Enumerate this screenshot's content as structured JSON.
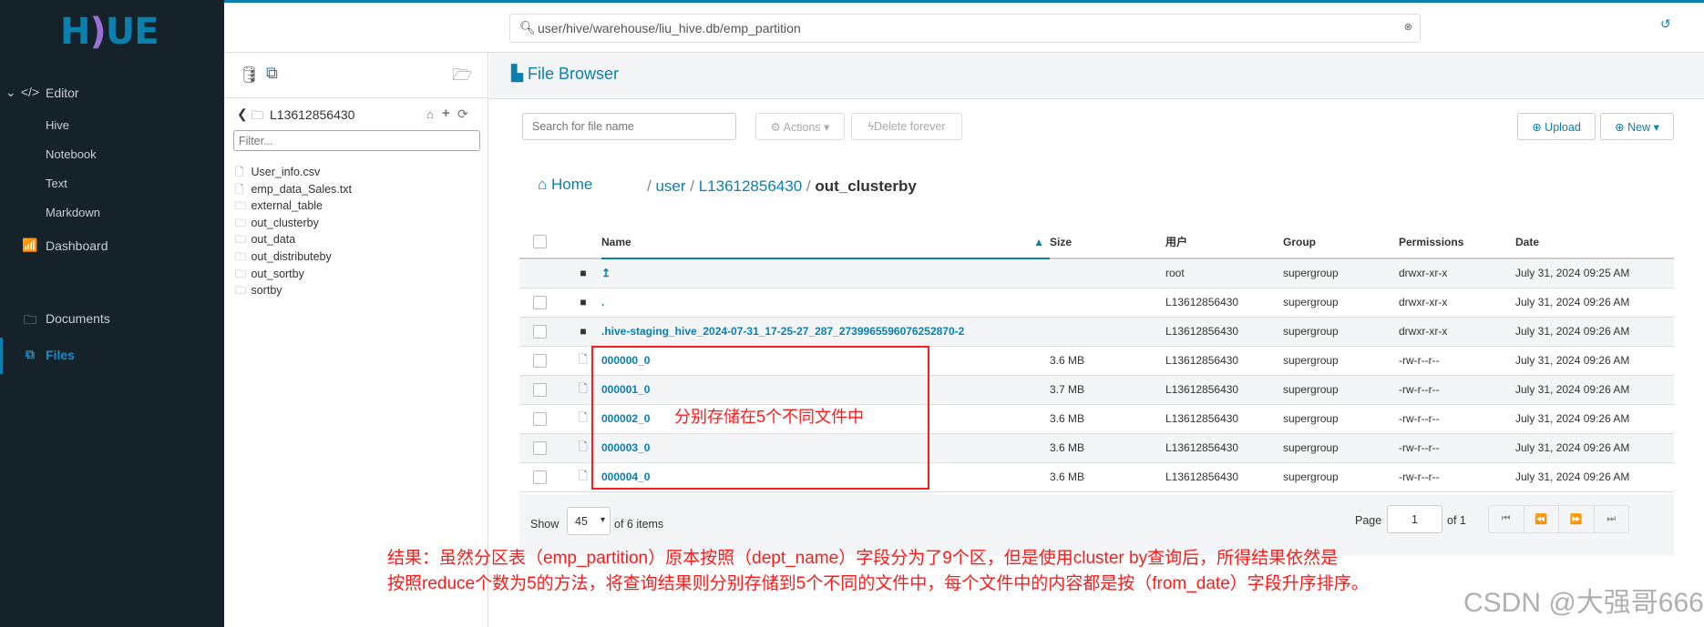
{
  "app": {
    "logo": "HUE"
  },
  "sidebar": {
    "editor": "Editor",
    "sub": [
      "Hive",
      "Notebook",
      "Text",
      "Markdown"
    ],
    "dashboard": "Dashboard",
    "documents": "Documents",
    "files": "Files"
  },
  "topbar": {
    "search_value": "user/hive/warehouse/liu_hive.db/emp_partition"
  },
  "leftpanel": {
    "folder": "L13612856430",
    "filter_placeholder": "Filter...",
    "items": [
      {
        "name": "User_info.csv",
        "type": "file"
      },
      {
        "name": "emp_data_Sales.txt",
        "type": "file"
      },
      {
        "name": "external_table",
        "type": "folder"
      },
      {
        "name": "out_clusterby",
        "type": "folder"
      },
      {
        "name": "out_data",
        "type": "folder"
      },
      {
        "name": "out_distributeby",
        "type": "folder"
      },
      {
        "name": "out_sortby",
        "type": "folder"
      },
      {
        "name": "sortby",
        "type": "folder"
      }
    ]
  },
  "main": {
    "title": "File Browser",
    "search_placeholder": "Search for file name",
    "actions": "Actions",
    "delete": "Delete forever",
    "upload": "Upload",
    "new": "New",
    "breadcrumb": {
      "home": "Home",
      "parts": [
        "user",
        "L13612856430"
      ],
      "current": "out_clusterby"
    },
    "columns": [
      "Name",
      "Size",
      "用户",
      "Group",
      "Permissions",
      "Date"
    ],
    "rows": [
      {
        "name": "↥",
        "size": "",
        "user": "root",
        "group": "supergroup",
        "perm": "drwxr-xr-x",
        "date": "July 31, 2024 09:25 AM",
        "type": "folder"
      },
      {
        "name": ".",
        "size": "",
        "user": "L13612856430",
        "group": "supergroup",
        "perm": "drwxr-xr-x",
        "date": "July 31, 2024 09:26 AM",
        "type": "folder"
      },
      {
        "name": ".hive-staging_hive_2024-07-31_17-25-27_287_2739965596076252870-2",
        "size": "",
        "user": "L13612856430",
        "group": "supergroup",
        "perm": "drwxr-xr-x",
        "date": "July 31, 2024 09:26 AM",
        "type": "folder"
      },
      {
        "name": "000000_0",
        "size": "3.6 MB",
        "user": "L13612856430",
        "group": "supergroup",
        "perm": "-rw-r--r--",
        "date": "July 31, 2024 09:26 AM",
        "type": "file"
      },
      {
        "name": "000001_0",
        "size": "3.7 MB",
        "user": "L13612856430",
        "group": "supergroup",
        "perm": "-rw-r--r--",
        "date": "July 31, 2024 09:26 AM",
        "type": "file"
      },
      {
        "name": "000002_0",
        "size": "3.6 MB",
        "user": "L13612856430",
        "group": "supergroup",
        "perm": "-rw-r--r--",
        "date": "July 31, 2024 09:26 AM",
        "type": "file"
      },
      {
        "name": "000003_0",
        "size": "3.6 MB",
        "user": "L13612856430",
        "group": "supergroup",
        "perm": "-rw-r--r--",
        "date": "July 31, 2024 09:26 AM",
        "type": "file"
      },
      {
        "name": "000004_0",
        "size": "3.6 MB",
        "user": "L13612856430",
        "group": "supergroup",
        "perm": "-rw-r--r--",
        "date": "July 31, 2024 09:26 AM",
        "type": "file"
      }
    ],
    "pager": {
      "show": "Show",
      "page_size": "45",
      "of_items": "of 6 items",
      "page_label": "Page",
      "page": "1",
      "of_pages": "of 1"
    }
  },
  "annotations": {
    "box_note": "分别存储在5个不同文件中",
    "line1": "结果：虽然分区表（emp_partition）原本按照（dept_name）字段分为了9个区，但是使用cluster by查询后，所得结果依然是",
    "line2": "按照reduce个数为5的方法，将查询结果则分别存储到5个不同的文件中，每个文件中的内容都是按（from_date）字段升序排序。",
    "watermark": "CSDN @大强哥666"
  },
  "colors": {
    "accent": "#0b7fad",
    "sidebar": "#16222a",
    "annotation": "#ff1a1a"
  }
}
